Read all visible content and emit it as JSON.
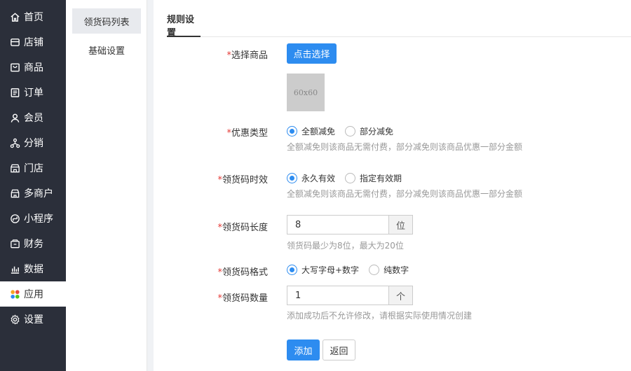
{
  "sidebar": {
    "items": [
      {
        "label": "首页",
        "icon": "home-icon"
      },
      {
        "label": "店铺",
        "icon": "store-icon"
      },
      {
        "label": "商品",
        "icon": "goods-icon"
      },
      {
        "label": "订单",
        "icon": "order-icon"
      },
      {
        "label": "会员",
        "icon": "member-icon"
      },
      {
        "label": "分销",
        "icon": "distribution-icon"
      },
      {
        "label": "门店",
        "icon": "shop-icon"
      },
      {
        "label": "多商户",
        "icon": "merchant-icon"
      },
      {
        "label": "小程序",
        "icon": "miniprogram-icon"
      },
      {
        "label": "财务",
        "icon": "finance-icon"
      },
      {
        "label": "数据",
        "icon": "data-icon"
      },
      {
        "label": "应用",
        "icon": "apps-icon"
      },
      {
        "label": "设置",
        "icon": "settings-icon"
      }
    ],
    "active": "应用"
  },
  "subnav": {
    "items": [
      {
        "label": "领货码列表"
      },
      {
        "label": "基础设置"
      }
    ],
    "active": "领货码列表"
  },
  "tabs": {
    "active_label": "规则设置"
  },
  "form": {
    "required_mark": "*",
    "product": {
      "label": "选择商品",
      "button": "点击选择",
      "thumb_text": "60x60"
    },
    "discount_type": {
      "label": "优惠类型",
      "options": [
        "全额减免",
        "部分减免"
      ],
      "selected": "全额减免",
      "help": "全额减免则该商品无需付费，部分减免则该商品优惠一部分金额"
    },
    "validity": {
      "label": "领货码时效",
      "options": [
        "永久有效",
        "指定有效期"
      ],
      "selected": "永久有效",
      "help": "全额减免则该商品无需付费，部分减免则该商品优惠一部分金额"
    },
    "code_length": {
      "label": "领货码长度",
      "value": "8",
      "unit": "位",
      "help": "领货码最少为8位，最大为20位"
    },
    "code_format": {
      "label": "领货码格式",
      "options": [
        "大写字母+数字",
        "纯数字"
      ],
      "selected": "大写字母+数字"
    },
    "code_count": {
      "label": "领货码数量",
      "value": "1",
      "unit": "个",
      "help": "添加成功后不允许修改，请根据实际使用情况创建"
    },
    "submit": "添加",
    "back": "返回"
  },
  "colors": {
    "sidebar_bg": "#2b2f3a",
    "primary": "#2d8cf0",
    "required": "#e53935"
  }
}
